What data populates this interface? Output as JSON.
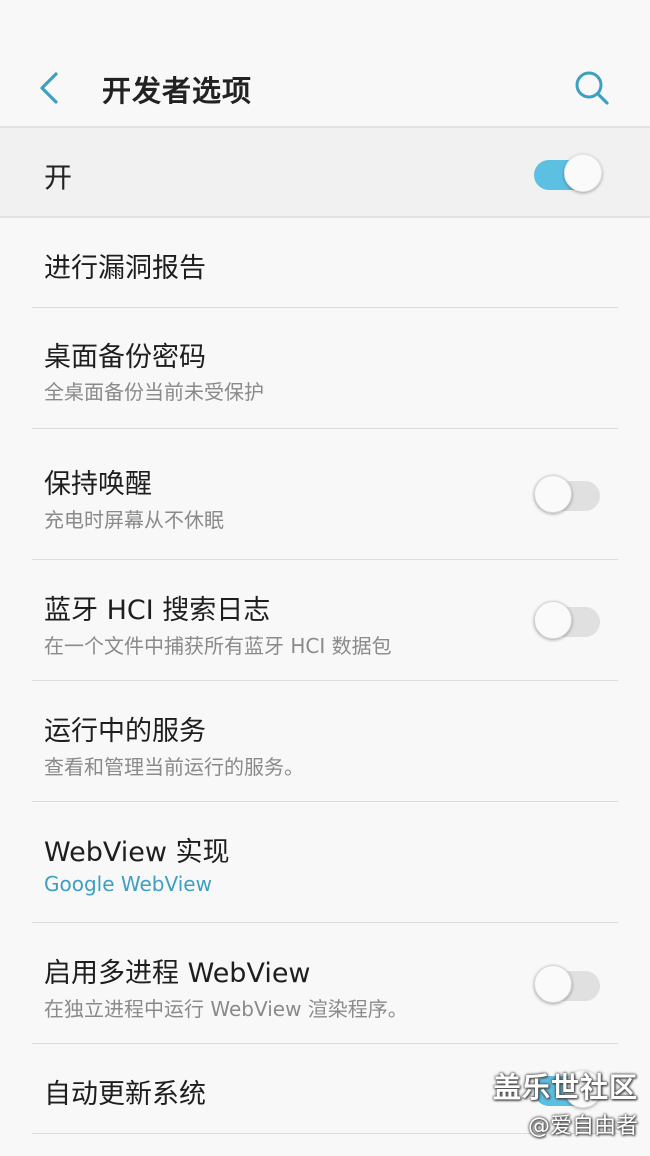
{
  "header": {
    "title": "开发者选项",
    "back_icon": "chevron-left-icon",
    "search_icon": "search-icon",
    "accent_color": "#3e9fc1"
  },
  "master_switch": {
    "label": "开",
    "state": true,
    "on_color": "#5cc0e3"
  },
  "items": [
    {
      "title": "进行漏洞报告",
      "subtitle": "",
      "toggle": null
    },
    {
      "title": "桌面备份密码",
      "subtitle": "全桌面备份当前未受保护",
      "toggle": null
    },
    {
      "title": "保持唤醒",
      "subtitle": "充电时屏幕从不休眠",
      "toggle": false
    },
    {
      "title": "蓝牙 HCI 搜索日志",
      "subtitle": "在一个文件中捕获所有蓝牙 HCI 数据包",
      "toggle": false
    },
    {
      "title": "运行中的服务",
      "subtitle": "查看和管理当前运行的服务。",
      "toggle": null
    },
    {
      "title": "WebView 实现",
      "subtitle": "Google WebView",
      "toggle": null
    },
    {
      "title": "启用多进程 WebView",
      "subtitle": "在独立进程中运行 WebView 渲染程序。",
      "toggle": false
    },
    {
      "title": "自动更新系统",
      "subtitle": "",
      "toggle": true
    }
  ],
  "watermark": {
    "title": "盖乐世社区",
    "user": "@爱自由者"
  }
}
